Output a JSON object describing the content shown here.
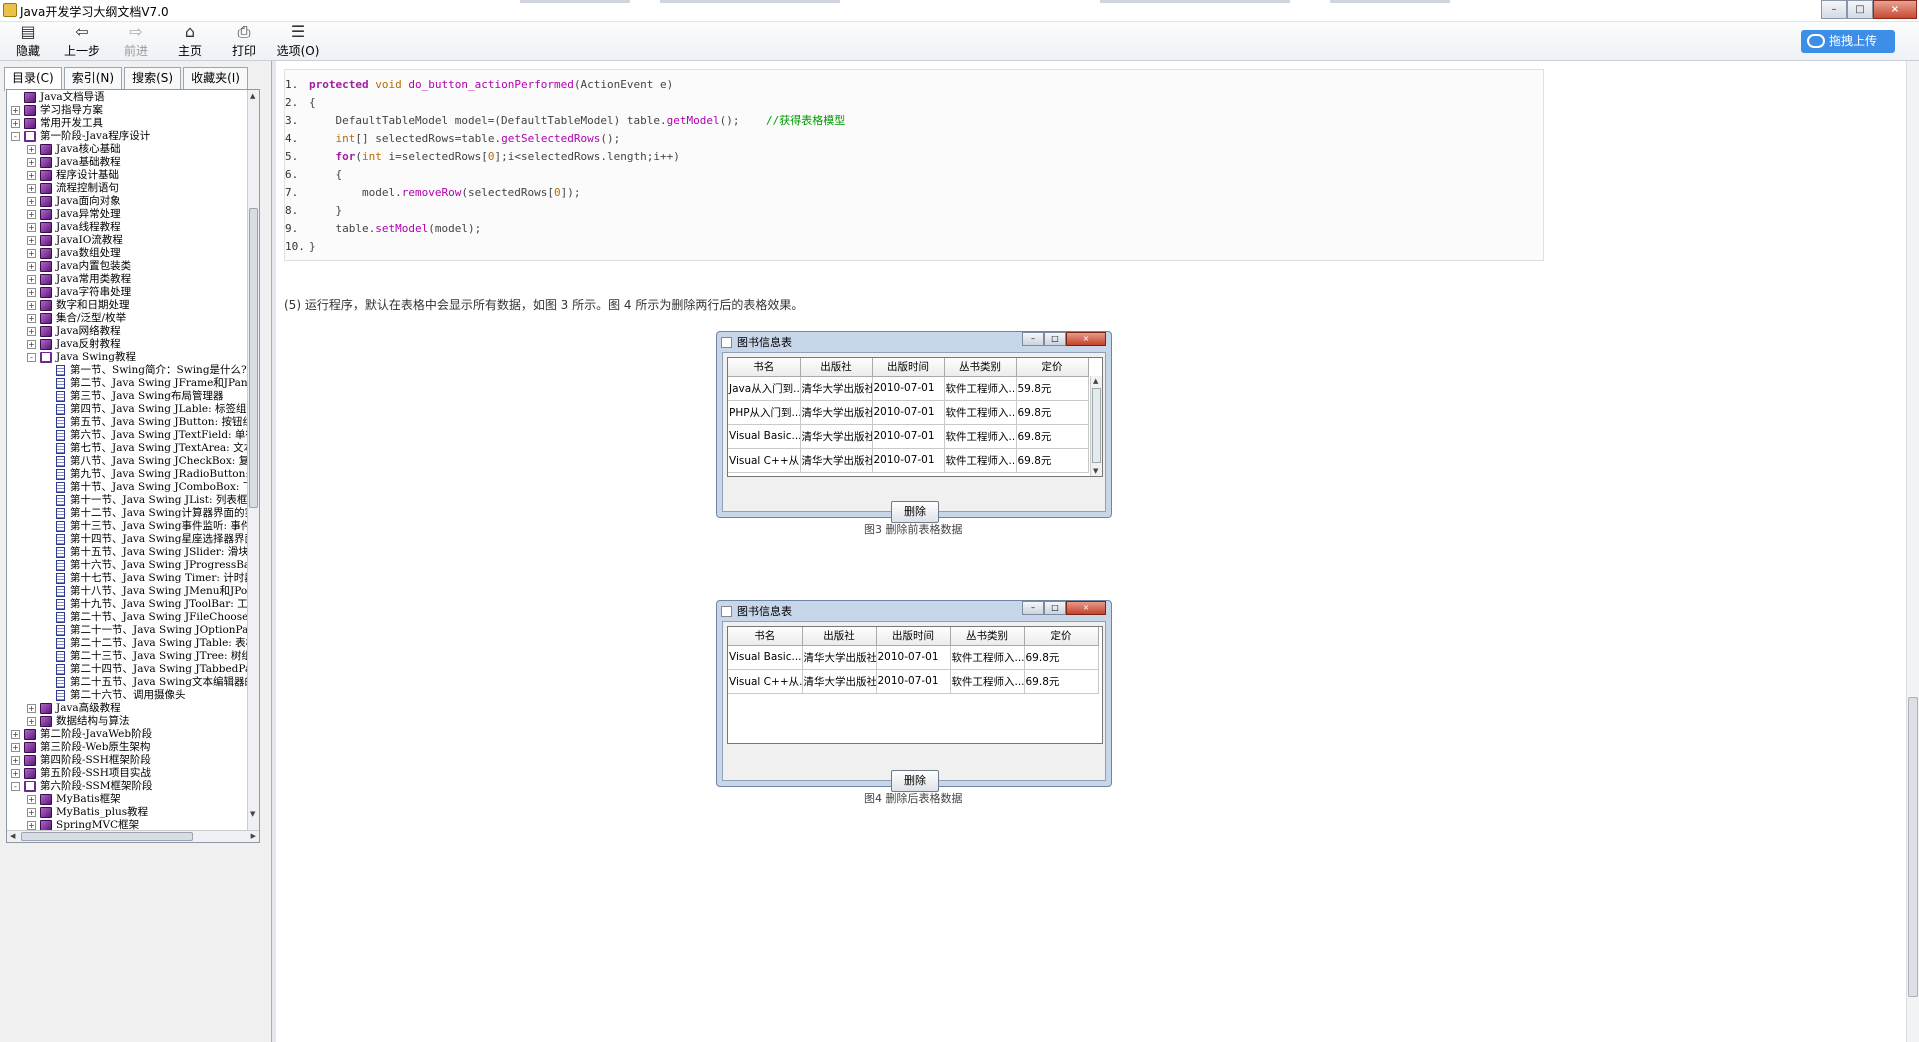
{
  "window": {
    "title": "Java开发学习大纲文档V7.0",
    "min_glyph": "–",
    "max_glyph": "□",
    "close_glyph": "×"
  },
  "toolbar": {
    "buttons": [
      {
        "label": "隐藏",
        "icon": "hide-icon",
        "glyph": "▤"
      },
      {
        "label": "上一步",
        "icon": "back-arrow-icon",
        "glyph": "⇦"
      },
      {
        "label": "前进",
        "icon": "forward-arrow-icon",
        "glyph": "⇨"
      },
      {
        "label": "主页",
        "icon": "home-icon",
        "glyph": "⌂"
      },
      {
        "label": "打印",
        "icon": "printer-icon",
        "glyph": "⎙"
      },
      {
        "label": "选项(O)",
        "icon": "options-icon",
        "glyph": "☰"
      }
    ],
    "upload_label": "拖拽上传"
  },
  "tabs": [
    "目录(C)",
    "索引(N)",
    "搜索(S)",
    "收藏夹(I)"
  ],
  "tree": [
    {
      "label": "Java文档导语",
      "indent": 0,
      "exp": "",
      "icon": "book"
    },
    {
      "label": "学习指导方案",
      "indent": 0,
      "exp": "+",
      "icon": "book"
    },
    {
      "label": "常用开发工具",
      "indent": 0,
      "exp": "+",
      "icon": "book"
    },
    {
      "label": "第一阶段-Java程序设计",
      "indent": 0,
      "exp": "-",
      "icon": "open"
    },
    {
      "label": "Java核心基础",
      "indent": 1,
      "exp": "+",
      "icon": "book"
    },
    {
      "label": "Java基础教程",
      "indent": 1,
      "exp": "+",
      "icon": "book"
    },
    {
      "label": "程序设计基础",
      "indent": 1,
      "exp": "+",
      "icon": "book"
    },
    {
      "label": "流程控制语句",
      "indent": 1,
      "exp": "+",
      "icon": "book"
    },
    {
      "label": "Java面向对象",
      "indent": 1,
      "exp": "+",
      "icon": "book"
    },
    {
      "label": "Java异常处理",
      "indent": 1,
      "exp": "+",
      "icon": "book"
    },
    {
      "label": "Java线程教程",
      "indent": 1,
      "exp": "+",
      "icon": "book"
    },
    {
      "label": "JavaIO流教程",
      "indent": 1,
      "exp": "+",
      "icon": "book"
    },
    {
      "label": "Java数组处理",
      "indent": 1,
      "exp": "+",
      "icon": "book"
    },
    {
      "label": "Java内置包装类",
      "indent": 1,
      "exp": "+",
      "icon": "book"
    },
    {
      "label": "Java常用类教程",
      "indent": 1,
      "exp": "+",
      "icon": "book"
    },
    {
      "label": "Java字符串处理",
      "indent": 1,
      "exp": "+",
      "icon": "book"
    },
    {
      "label": "数字和日期处理",
      "indent": 1,
      "exp": "+",
      "icon": "book"
    },
    {
      "label": "集合/泛型/枚举",
      "indent": 1,
      "exp": "+",
      "icon": "book"
    },
    {
      "label": "Java网络教程",
      "indent": 1,
      "exp": "+",
      "icon": "book"
    },
    {
      "label": "Java反射教程",
      "indent": 1,
      "exp": "+",
      "icon": "book"
    },
    {
      "label": "Java Swing教程",
      "indent": 1,
      "exp": "-",
      "icon": "open"
    },
    {
      "label": "第一节、Swing简介：Swing是什么?",
      "indent": 2,
      "exp": "",
      "icon": "page"
    },
    {
      "label": "第二节、Java Swing JFrame和JPanel: 窗",
      "indent": 2,
      "exp": "",
      "icon": "page"
    },
    {
      "label": "第三节、Java Swing布局管理器",
      "indent": 2,
      "exp": "",
      "icon": "page"
    },
    {
      "label": "第四节、Java Swing JLable: 标签组件",
      "indent": 2,
      "exp": "",
      "icon": "page"
    },
    {
      "label": "第五节、Java Swing JButton: 按钮组件",
      "indent": 2,
      "exp": "",
      "icon": "page"
    },
    {
      "label": "第六节、Java Swing JTextField: 单行文本",
      "indent": 2,
      "exp": "",
      "icon": "page"
    },
    {
      "label": "第七节、Java Swing JTextArea: 文本域",
      "indent": 2,
      "exp": "",
      "icon": "page"
    },
    {
      "label": "第八节、Java Swing JCheckBox: 复选框",
      "indent": 2,
      "exp": "",
      "icon": "page"
    },
    {
      "label": "第九节、Java Swing JRadioButton: 单选",
      "indent": 2,
      "exp": "",
      "icon": "page"
    },
    {
      "label": "第十节、Java Swing JComboBox: 下拉列",
      "indent": 2,
      "exp": "",
      "icon": "page"
    },
    {
      "label": "第十一节、Java Swing JList: 列表框组件",
      "indent": 2,
      "exp": "",
      "icon": "page"
    },
    {
      "label": "第十二节、Java Swing计算器界面的实现",
      "indent": 2,
      "exp": "",
      "icon": "page"
    },
    {
      "label": "第十三节、Java Swing事件监听: 事件处",
      "indent": 2,
      "exp": "",
      "icon": "page"
    },
    {
      "label": "第十四节、Java Swing星座选择器界面的",
      "indent": 2,
      "exp": "",
      "icon": "page"
    },
    {
      "label": "第十五节、Java Swing JSlider: 滑块组件",
      "indent": 2,
      "exp": "",
      "icon": "page"
    },
    {
      "label": "第十六节、Java Swing JProgressBar: 进",
      "indent": 2,
      "exp": "",
      "icon": "page"
    },
    {
      "label": "第十七节、Java Swing Timer: 计时器组件",
      "indent": 2,
      "exp": "",
      "icon": "page"
    },
    {
      "label": "第十八节、Java Swing JMenu和JPopupMenu",
      "indent": 2,
      "exp": "",
      "icon": "page"
    },
    {
      "label": "第十九节、Java Swing JToolBar: 工具栏",
      "indent": 2,
      "exp": "",
      "icon": "page"
    },
    {
      "label": "第二十节、Java Swing JFileChooser和JCo",
      "indent": 2,
      "exp": "",
      "icon": "page"
    },
    {
      "label": "第二十一节、Java Swing JOptionPane: 对",
      "indent": 2,
      "exp": "",
      "icon": "page"
    },
    {
      "label": "第二十二节、Java Swing JTable: 表格组件",
      "indent": 2,
      "exp": "",
      "icon": "page"
    },
    {
      "label": "第二十三节、Java Swing JTree: 树组件",
      "indent": 2,
      "exp": "",
      "icon": "page"
    },
    {
      "label": "第二十四节、Java Swing JTabbedPane: 选",
      "indent": 2,
      "exp": "",
      "icon": "page"
    },
    {
      "label": "第二十五节、Java Swing文本编辑器的实现",
      "indent": 2,
      "exp": "",
      "icon": "page"
    },
    {
      "label": "第二十六节、调用摄像头",
      "indent": 2,
      "exp": "",
      "icon": "page"
    },
    {
      "label": "Java高级教程",
      "indent": 1,
      "exp": "+",
      "icon": "book"
    },
    {
      "label": "数据结构与算法",
      "indent": 1,
      "exp": "+",
      "icon": "book"
    },
    {
      "label": "第二阶段-JavaWeb阶段",
      "indent": 0,
      "exp": "+",
      "icon": "book"
    },
    {
      "label": "第三阶段-Web原生架构",
      "indent": 0,
      "exp": "+",
      "icon": "book"
    },
    {
      "label": "第四阶段-SSH框架阶段",
      "indent": 0,
      "exp": "+",
      "icon": "book"
    },
    {
      "label": "第五阶段-SSH项目实战",
      "indent": 0,
      "exp": "+",
      "icon": "book"
    },
    {
      "label": "第六阶段-SSM框架阶段",
      "indent": 0,
      "exp": "-",
      "icon": "open"
    },
    {
      "label": "MyBatis框架",
      "indent": 1,
      "exp": "+",
      "icon": "book"
    },
    {
      "label": "MyBatis_plus教程",
      "indent": 1,
      "exp": "+",
      "icon": "book"
    },
    {
      "label": "SpringMVC框架",
      "indent": 1,
      "exp": "+",
      "icon": "book"
    }
  ],
  "code_lines": [
    {
      "n": "1.",
      "parts": [
        {
          "t": "protected ",
          "c": "kw"
        },
        {
          "t": "void ",
          "c": "nm"
        },
        {
          "t": "do_button_actionPerformed",
          "c": "fn"
        },
        {
          "t": "(ActionEvent e)",
          "c": "tx"
        }
      ]
    },
    {
      "n": "2.",
      "parts": [
        {
          "t": "{",
          "c": "tx"
        }
      ]
    },
    {
      "n": "3.",
      "parts": [
        {
          "t": "    DefaultTableModel model=(DefaultTableModel) table.",
          "c": "tx"
        },
        {
          "t": "getModel",
          "c": "fn"
        },
        {
          "t": "();    ",
          "c": "tx"
        },
        {
          "t": "//获得表格模型",
          "c": "cm"
        }
      ]
    },
    {
      "n": "4.",
      "parts": [
        {
          "t": "    ",
          "c": "tx"
        },
        {
          "t": "int",
          "c": "nm"
        },
        {
          "t": "[] selectedRows=table.",
          "c": "tx"
        },
        {
          "t": "getSelectedRows",
          "c": "fn"
        },
        {
          "t": "();",
          "c": "tx"
        }
      ]
    },
    {
      "n": "5.",
      "parts": [
        {
          "t": "    ",
          "c": "tx"
        },
        {
          "t": "for",
          "c": "kw"
        },
        {
          "t": "(",
          "c": "tx"
        },
        {
          "t": "int",
          "c": "nm"
        },
        {
          "t": " i=selectedRows[",
          "c": "tx"
        },
        {
          "t": "0",
          "c": "nm"
        },
        {
          "t": "];i<selectedRows.length;i++)",
          "c": "tx"
        }
      ]
    },
    {
      "n": "6.",
      "parts": [
        {
          "t": "    {",
          "c": "tx"
        }
      ]
    },
    {
      "n": "7.",
      "parts": [
        {
          "t": "        model.",
          "c": "tx"
        },
        {
          "t": "removeRow",
          "c": "fn"
        },
        {
          "t": "(selectedRows[",
          "c": "tx"
        },
        {
          "t": "0",
          "c": "nm"
        },
        {
          "t": "]);",
          "c": "tx"
        }
      ]
    },
    {
      "n": "8.",
      "parts": [
        {
          "t": "    }",
          "c": "tx"
        }
      ]
    },
    {
      "n": "9.",
      "parts": [
        {
          "t": "    table.",
          "c": "tx"
        },
        {
          "t": "setModel",
          "c": "fn"
        },
        {
          "t": "(model);",
          "c": "tx"
        }
      ]
    },
    {
      "n": "10.",
      "parts": [
        {
          "t": "}",
          "c": "tx"
        }
      ]
    }
  ],
  "paragraph": "(5) 运行程序，默认在表格中会显示所有数据，如图 3 所示。图 4 所示为删除两行后的表格效果。",
  "dialogs": [
    {
      "title": "图书信息表",
      "headers": [
        "书名",
        "出版社",
        "出版时间",
        "丛书类别",
        "定价"
      ],
      "rows": [
        [
          "Java从入门到...",
          "清华大学出版社",
          "2010-07-01",
          "软件工程师入...",
          "59.8元"
        ],
        [
          "PHP从入门到...",
          "清华大学出版社",
          "2010-07-01",
          "软件工程师入...",
          "69.8元"
        ],
        [
          "Visual Basic...",
          "清华大学出版社",
          "2010-07-01",
          "软件工程师入...",
          "69.8元"
        ],
        [
          "Visual C++从...",
          "清华大学出版社",
          "2010-07-01",
          "软件工程师入...",
          "69.8元"
        ]
      ],
      "button": "删除",
      "caption": "图3 删除前表格数据"
    },
    {
      "title": "图书信息表",
      "headers": [
        "书名",
        "出版社",
        "出版时间",
        "丛书类别",
        "定价"
      ],
      "rows": [
        [
          "Visual Basic...",
          "清华大学出版社",
          "2010-07-01",
          "软件工程师入...",
          "69.8元"
        ],
        [
          "Visual C++从...",
          "清华大学出版社",
          "2010-07-01",
          "软件工程师入...",
          "69.8元"
        ]
      ],
      "button": "删除",
      "caption": "图4 删除后表格数据"
    }
  ]
}
